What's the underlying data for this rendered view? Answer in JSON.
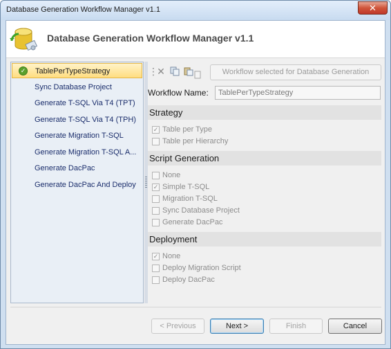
{
  "window": {
    "title": "Database Generation Workflow Manager v1.1",
    "close_symbol": "✕"
  },
  "header": {
    "title": "Database Generation Workflow Manager v1.1",
    "icon": "database-icon"
  },
  "steps": {
    "items": [
      {
        "label": "TablePerTypeStrategy",
        "selected": true,
        "icon": "check-icon"
      },
      {
        "label": "Sync Database Project"
      },
      {
        "label": "Generate T-SQL Via T4 (TPT)"
      },
      {
        "label": "Generate T-SQL Via T4 (TPH)"
      },
      {
        "label": "Generate Migration T-SQL"
      },
      {
        "label": "Generate Migration T-SQL A..."
      },
      {
        "label": "Generate DacPac"
      },
      {
        "label": "Generate DacPac And Deploy"
      }
    ]
  },
  "toolbar": {
    "icons": [
      "delete-icon",
      "copy-icon",
      "paste-icon",
      "add-icon"
    ],
    "workflow_selected_label": "Workflow selected for Database Generation"
  },
  "workflow": {
    "name_label": "Workflow Name:",
    "name_value": "TablePerTypeStrategy"
  },
  "strategy": {
    "title": "Strategy",
    "options": [
      {
        "label": "Table per Type",
        "checked": true
      },
      {
        "label": "Table per Hierarchy",
        "checked": false
      }
    ]
  },
  "script_generation": {
    "title": "Script Generation",
    "options": [
      {
        "label": "None",
        "checked": false
      },
      {
        "label": "Simple T-SQL",
        "checked": true
      },
      {
        "label": "Migration T-SQL",
        "checked": false
      },
      {
        "label": "Sync Database Project",
        "checked": false
      },
      {
        "label": "Generate DacPac",
        "checked": false
      }
    ]
  },
  "deployment": {
    "title": "Deployment",
    "options": [
      {
        "label": "None",
        "checked": true
      },
      {
        "label": "Deploy Migration Script",
        "checked": false
      },
      {
        "label": "Deploy DacPac",
        "checked": false
      }
    ]
  },
  "footer": {
    "previous_label": "< Previous",
    "next_label": "Next >",
    "finish_label": "Finish",
    "cancel_label": "Cancel"
  },
  "check_mark": "✓"
}
